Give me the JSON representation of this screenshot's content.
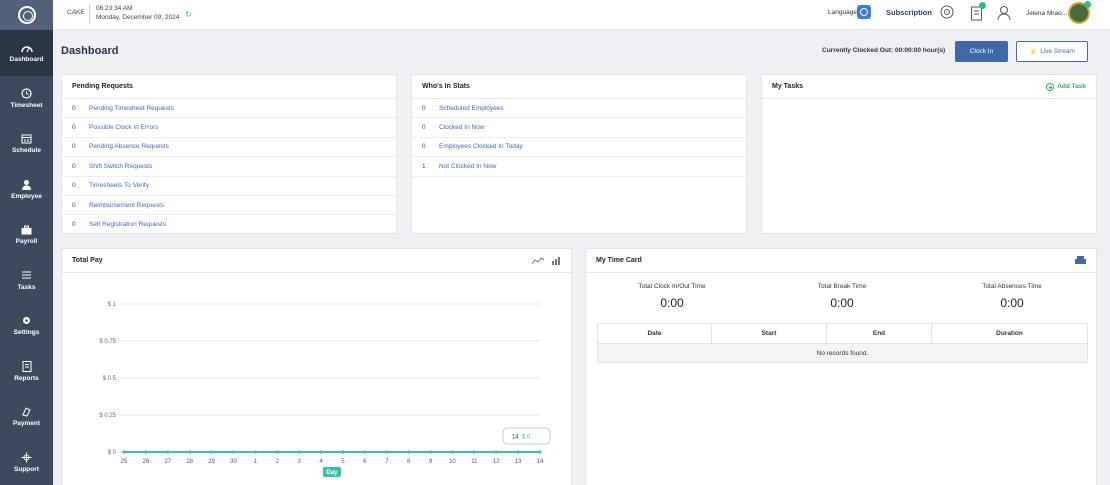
{
  "sidebar": {
    "items": [
      {
        "label": "Dashboard",
        "icon": "gauge-icon"
      },
      {
        "label": "Timesheet",
        "icon": "clock-icon"
      },
      {
        "label": "Schedule",
        "icon": "calendar-icon"
      },
      {
        "label": "Employee",
        "icon": "person-icon"
      },
      {
        "label": "Payroll",
        "icon": "briefcase-icon"
      },
      {
        "label": "Tasks",
        "icon": "list-icon"
      },
      {
        "label": "Settings",
        "icon": "gear-icon"
      },
      {
        "label": "Reports",
        "icon": "report-icon"
      },
      {
        "label": "Payment",
        "icon": "payment-icon"
      },
      {
        "label": "Support",
        "icon": "support-icon"
      }
    ]
  },
  "topbar": {
    "company": "CAKE",
    "time": "06:23:34 AM",
    "date": "Monday, December 09, 2024",
    "language_label": "Language:",
    "subscription": "Subscription",
    "username": "Jelena Mrao..."
  },
  "header": {
    "title": "Dashboard",
    "clocked_status": "Currently Clocked Out: 00:00:00 hour(s)",
    "clock_in": "Clock In",
    "live_stream": "Live Stream"
  },
  "pending": {
    "title": "Pending Requests",
    "rows": [
      {
        "count": "0",
        "label": "Pending Timesheet Requests"
      },
      {
        "count": "0",
        "label": "Possible Clock In Errors"
      },
      {
        "count": "0",
        "label": "Pending Absence Requests"
      },
      {
        "count": "0",
        "label": "Shift Switch Requests"
      },
      {
        "count": "0",
        "label": "Timesheets To Verify"
      },
      {
        "count": "0",
        "label": "Reimbursement Requests"
      },
      {
        "count": "0",
        "label": "Self Registration Requests"
      }
    ]
  },
  "whosin": {
    "title": "Who's In Stats",
    "rows": [
      {
        "count": "0",
        "label": "Scheduled Employees"
      },
      {
        "count": "0",
        "label": "Clocked In Now"
      },
      {
        "count": "0",
        "label": "Employees Clocked In Today"
      },
      {
        "count": "1",
        "label": "Not Clocked In Now"
      }
    ]
  },
  "tasks": {
    "title": "My Tasks",
    "add_label": "Add Task"
  },
  "totalpay": {
    "title": "Total Pay"
  },
  "timecard": {
    "title": "My Time Card",
    "stats": [
      {
        "label": "Total Clock In/Out Time",
        "value": "0:00"
      },
      {
        "label": "Total Break Time",
        "value": "0:00"
      },
      {
        "label": "Total Absences Time",
        "value": "0:00"
      }
    ],
    "columns": [
      "Date",
      "Start",
      "End",
      "Duration"
    ],
    "empty": "No records found."
  },
  "chart_data": {
    "type": "line",
    "title": "",
    "xlabel": "Day",
    "ylabel": "",
    "categories": [
      "25",
      "26",
      "27",
      "28",
      "29",
      "30",
      "1",
      "2",
      "3",
      "4",
      "5",
      "6",
      "7",
      "8",
      "9",
      "10",
      "11",
      "12",
      "13",
      "14"
    ],
    "series": [
      {
        "values": [
          0,
          0,
          0,
          0,
          0,
          0,
          0,
          0,
          0,
          0,
          0,
          0,
          0,
          0,
          0,
          0,
          0,
          0,
          0,
          0
        ]
      }
    ],
    "y_ticks": [
      "$ 0",
      "$ 0.25",
      "$ 0.5",
      "$ 0.75",
      "$ 1"
    ],
    "ylim": [
      0,
      1
    ],
    "grid": true,
    "tooltip": {
      "label": "14",
      "value": "$ 0"
    },
    "line_color": "#3cc0a8"
  }
}
